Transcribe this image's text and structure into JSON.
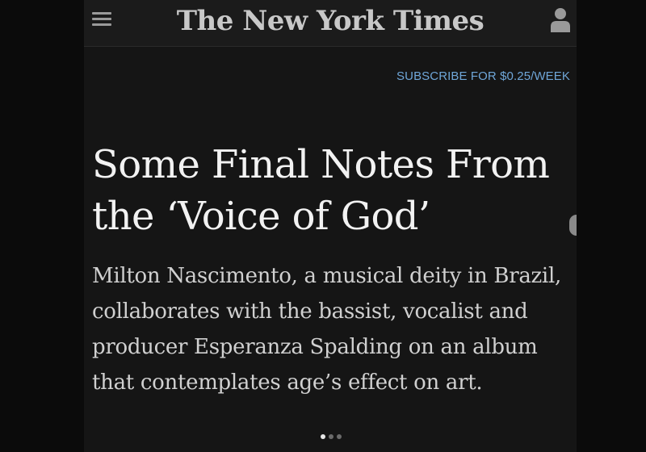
{
  "header": {
    "menu_icon": "hamburger-menu-icon",
    "logo_text": "The New York Times",
    "account_icon": "user-account-icon"
  },
  "subscribe": {
    "label": "SUBSCRIBE FOR $0.25/WEEK"
  },
  "article": {
    "headline": "Some Final Notes From the ‘Voice of God’",
    "summary": "Milton Nascimento, a musical deity in Brazil, collaborates with the bassist, vocalist and producer Esperanza Spalding on an album that contemplates age’s effect on art."
  },
  "pager": {
    "total_pages": 3,
    "current_page": 1
  },
  "colors": {
    "background": "#151515",
    "link": "#6fa6d8",
    "headline": "#f2f2f2",
    "summary": "#d0d0d0"
  }
}
